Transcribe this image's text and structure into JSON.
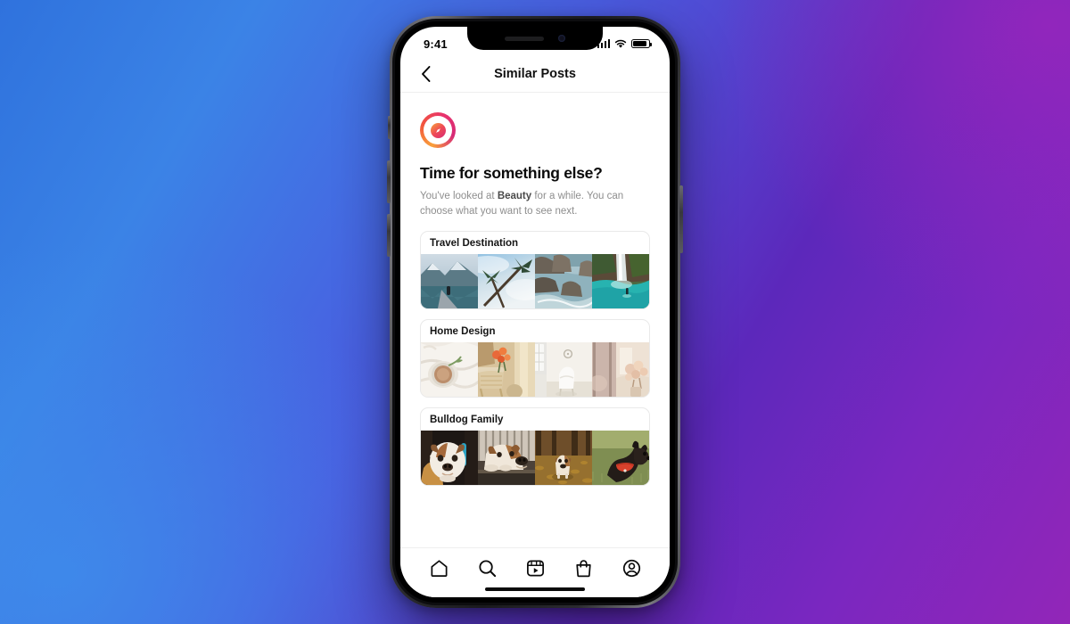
{
  "background": {
    "gradient_from": "#2f72dd",
    "gradient_mid": "#5c28bb",
    "gradient_to": "#9226b8"
  },
  "phone": {
    "status_bar": {
      "time": "9:41",
      "signal_icon": "cellular-bars-icon",
      "wifi_icon": "wifi-icon",
      "battery_icon": "battery-icon"
    },
    "notch": {
      "speaker_icon": "earpiece-speaker-icon",
      "camera_icon": "front-camera-icon"
    },
    "home_indicator": "home-indicator"
  },
  "navbar": {
    "back_icon": "chevron-left-icon",
    "title": "Similar Posts"
  },
  "content": {
    "brand_icon": "compass-icon",
    "headline": "Time for something else?",
    "subtitle_before": "You've looked at ",
    "subtitle_highlight": "Beauty",
    "subtitle_after": " for a while. You can choose what you want to see next.",
    "cards": [
      {
        "label": "Travel Destination",
        "thumbnails": [
          "person-on-dock-by-mountain-lake",
          "palm-trees-looking-up-at-sky",
          "rocky-coastline-with-ocean-waves",
          "waterfall-into-turquoise-pool"
        ]
      },
      {
        "label": "Home Design",
        "thumbnails": [
          "coffee-cup-on-white-bedding",
          "rattan-chair-with-orange-flowers",
          "minimal-white-room-with-chair",
          "bedroom-with-dried-flowers"
        ]
      },
      {
        "label": "Bulldog Family",
        "thumbnails": [
          "white-brown-bulldog-puppy-portrait",
          "english-bulldog-lying-on-bench",
          "bulldog-walking-in-autumn-leaves",
          "black-french-bulldog-with-red-collar"
        ]
      }
    ]
  },
  "tabbar": {
    "items": [
      {
        "icon": "home-icon",
        "label": "Home"
      },
      {
        "icon": "search-icon",
        "label": "Search"
      },
      {
        "icon": "reels-icon",
        "label": "Reels"
      },
      {
        "icon": "shop-icon",
        "label": "Shop"
      },
      {
        "icon": "profile-icon",
        "label": "Profile"
      }
    ]
  }
}
